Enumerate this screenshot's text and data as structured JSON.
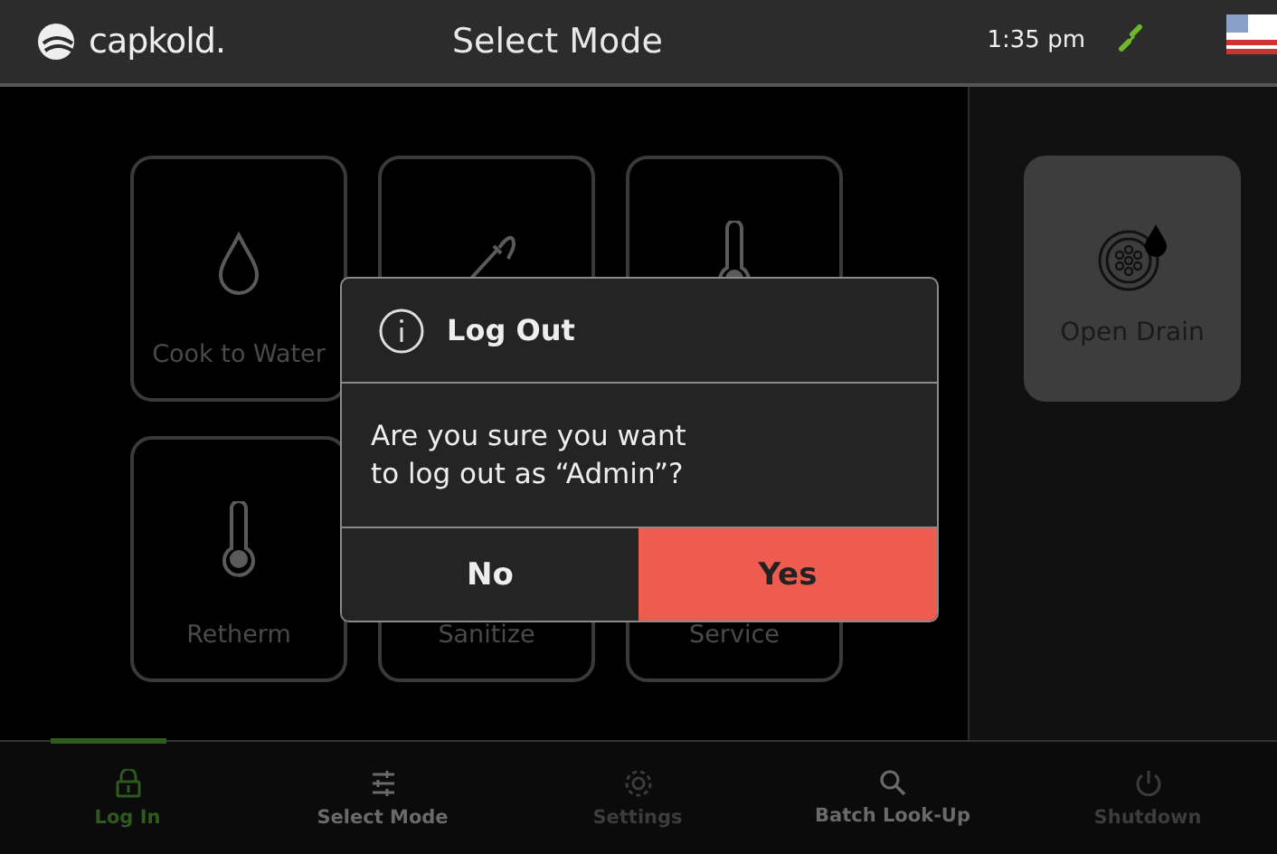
{
  "top_bar": {
    "brand": "capkold.",
    "title": "Select Mode",
    "time": "1:35 pm",
    "connected": true
  },
  "modes": [
    {
      "kind": "drop",
      "label": "Cook to Water"
    },
    {
      "kind": "probe"
    },
    {
      "kind": "thermometer"
    },
    {
      "kind": "thermometer",
      "label": "Retherm"
    },
    {
      "kind": "covered",
      "label": "Sanitize"
    },
    {
      "kind": "covered",
      "label": "Service"
    }
  ],
  "side_action": {
    "label": "Open Drain"
  },
  "dialog": {
    "title": "Log Out",
    "message": "Are you sure you want\nto log out as “Admin”?",
    "buttons": [
      {
        "label": "No",
        "kind": "secondary"
      },
      {
        "label": "Yes",
        "kind": "primary"
      }
    ]
  },
  "nav": [
    {
      "label": "Log In",
      "selected": true,
      "disabled": false
    },
    {
      "label": "Select Mode",
      "selected": false,
      "disabled": false
    },
    {
      "label": "Settings",
      "selected": false,
      "disabled": true
    },
    {
      "label": "Batch Look-Up",
      "selected": false,
      "disabled": false
    },
    {
      "label": "Shutdown",
      "selected": false,
      "disabled": true
    }
  ]
}
